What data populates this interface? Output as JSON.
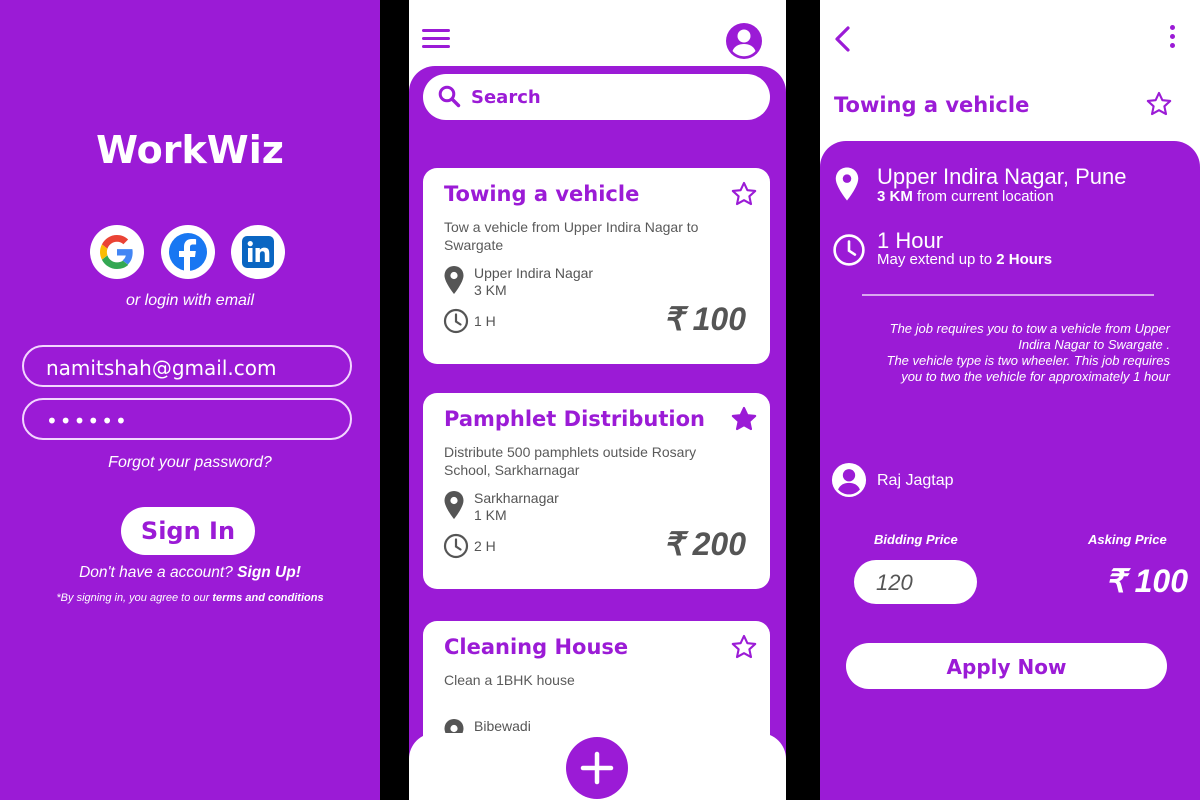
{
  "colors": {
    "brand_purple": "#9b1bd6",
    "white": "#ffffff",
    "gray_text": "#555555"
  },
  "login": {
    "app_name": "WorkWiz",
    "social_icons": [
      "google-icon",
      "facebook-icon",
      "linkedin-icon"
    ],
    "or_login_text": "or login with email",
    "email_value": "namitshah@gmail.com",
    "password_value": "••••••",
    "forgot_password": "Forgot your password?",
    "signin_label": "Sign In",
    "signup_prefix": "Don't have a account?",
    "signup_link": "Sign Up!",
    "terms_prefix": "*By signing in, you agree to our",
    "terms_link": "terms and conditions"
  },
  "list": {
    "search_placeholder": "Search",
    "jobs": [
      {
        "title": "Towing a vehicle",
        "description": "Tow a vehicle from Upper Indira Nagar to Swargate",
        "location": "Upper Indira Nagar",
        "distance": "3 KM",
        "duration": "1 H",
        "price": "₹ 100",
        "starred": false
      },
      {
        "title": "Pamphlet Distribution",
        "description": "Distribute 500 pamphlets outside Rosary School, Sarkharnagar",
        "location": "Sarkharnagar",
        "distance": "1 KM",
        "duration": "2 H",
        "price": "₹ 200",
        "starred": true
      },
      {
        "title": "Cleaning House",
        "description": "Clean a 1BHK house",
        "location": "Bibewadi",
        "starred": false
      }
    ]
  },
  "detail": {
    "title": "Towing a vehicle",
    "location": "Upper Indira Nagar, Pune",
    "distance_value": "3 KM",
    "distance_suffix": "from current location",
    "duration": "1 Hour",
    "extend_prefix": "May extend up to",
    "extend_value": "2 Hours",
    "description_lines": [
      "The job requires you to  tow a vehicle from Upper",
      "Indira Nagar to Swargate .",
      "The vehicle type is two wheeler. This job requires",
      "you to two the vehicle for approximately 1 hour"
    ],
    "poster_name": "Raj Jagtap",
    "bidding_label": "Bidding Price",
    "bidding_value": "120",
    "asking_label": "Asking Price",
    "asking_value": "₹ 100",
    "apply_label": "Apply Now"
  }
}
